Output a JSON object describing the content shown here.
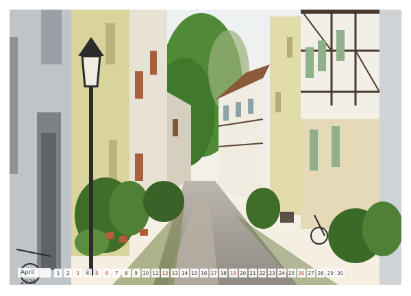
{
  "calendar": {
    "month_label": "April 2026",
    "days": [
      {
        "n": "1",
        "weekend": false
      },
      {
        "n": "2",
        "weekend": false
      },
      {
        "n": "3",
        "weekend": true
      },
      {
        "n": "4",
        "weekend": false
      },
      {
        "n": "5",
        "weekend": true
      },
      {
        "n": "6",
        "weekend": true
      },
      {
        "n": "7",
        "weekend": false
      },
      {
        "n": "8",
        "weekend": false
      },
      {
        "n": "9",
        "weekend": false
      },
      {
        "n": "10",
        "weekend": false
      },
      {
        "n": "11",
        "weekend": false
      },
      {
        "n": "12",
        "weekend": true
      },
      {
        "n": "13",
        "weekend": false
      },
      {
        "n": "14",
        "weekend": false
      },
      {
        "n": "15",
        "weekend": false
      },
      {
        "n": "16",
        "weekend": false
      },
      {
        "n": "17",
        "weekend": false
      },
      {
        "n": "18",
        "weekend": false
      },
      {
        "n": "19",
        "weekend": true
      },
      {
        "n": "20",
        "weekend": false
      },
      {
        "n": "21",
        "weekend": false
      },
      {
        "n": "22",
        "weekend": false
      },
      {
        "n": "23",
        "weekend": false
      },
      {
        "n": "24",
        "weekend": false
      },
      {
        "n": "25",
        "weekend": false
      },
      {
        "n": "26",
        "weekend": true
      },
      {
        "n": "27",
        "weekend": false
      },
      {
        "n": "28",
        "weekend": false
      },
      {
        "n": "29",
        "weekend": false
      },
      {
        "n": "30",
        "weekend": false
      }
    ]
  },
  "colors": {
    "weekend": "#c0392b",
    "weekday": "#333333",
    "strip_bg": "#ffffff"
  }
}
